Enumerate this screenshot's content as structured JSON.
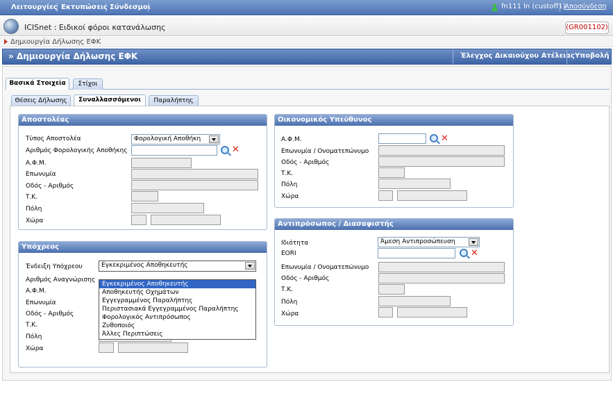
{
  "topbar": {
    "menu": [
      "Λειτουργίες",
      "Εκτυπώσεις",
      "Σύνδεσμοι"
    ],
    "user": "fn111 ln (custoff1)",
    "logout": "Αποσύνδεση",
    "user_icon": "user-icon"
  },
  "app": {
    "title": "ICISnet : Ειδικοί φόροι κατανάλωσης",
    "code": "(GR001102)"
  },
  "breadcrumb": "Δημιουργία Δήλωσης ΕΦΚ",
  "titlebar": {
    "title": "» Δημιουργία Δήλωσης ΕΦΚ",
    "check_button": "Έλεγχος Δικαιούχου Ατέλειας",
    "submit_button": "Υποβολή"
  },
  "tabs": [
    "Βασικά Στοιχεία",
    "Στίχοι"
  ],
  "subtabs": [
    "Θέσεις Δήλωσης",
    "Συναλλασσόμενοι",
    "Παραλήπτης"
  ],
  "sender": {
    "title": "Αποστολέας",
    "type_label": "Τύπος Αποστολέα",
    "type_value": "Φορολογική Αποθήκη",
    "warehouse_label": "Αριθμός Φορολογικής Αποθήκης",
    "afm_label": "Α.Φ.Μ.",
    "name_label": "Επωνυμία",
    "street_label": "Οδός - Αριθμός",
    "tk_label": "Τ.Κ.",
    "city_label": "Πόλη",
    "country_label": "Χώρα"
  },
  "obligor": {
    "title": "Υπόχρεος",
    "indication_label": "Ένδειξη Υπόχρεου",
    "indication_value": "Εγκεκριμένος Αποθηκευτής",
    "id_label": "Αριθμός Αναγνώρισης",
    "afm_label": "Α.Φ.Μ.",
    "name_label": "Επωνυμία",
    "street_label": "Οδός - Αριθμός",
    "tk_label": "Τ.Κ.",
    "city_label": "Πόλη",
    "country_label": "Χώρα"
  },
  "dropdown": {
    "options": [
      "Εγκεκριμένος Αποθηκευτής",
      "Αποθηκευτής Οχημάτων",
      "Εγγεγραμμένος Παραλήπτης",
      "Περιστασιακά Εγγεγραμμένος Παραλήπτης",
      "Φορολογικός Αντιπρόσωπος",
      "Ζυθοποιός",
      "Άλλες Περιπτώσεις"
    ],
    "selected": "Εγκεκριμένος Αποθηκευτής"
  },
  "financial": {
    "title": "Οικονομικός Υπεύθυνος",
    "afm_label": "Α.Φ.Μ.",
    "name_label": "Επωνυμία / Ονοματεπώνυμο",
    "street_label": "Οδός - Αριθμός",
    "tk_label": "Τ.Κ.",
    "city_label": "Πόλη",
    "country_label": "Χώρα"
  },
  "representative": {
    "title": "Αντιπρόσωπος / Διασαφιστής",
    "capacity_label": "Ιδιότητα",
    "capacity_value": "Άμεση Αντιπροσώπευση",
    "eori_label": "EORI",
    "name_label": "Επωνυμία / Ονοματεπώνυμο",
    "street_label": "Οδός - Αριθμός",
    "tk_label": "Τ.Κ.",
    "city_label": "Πόλη",
    "country_label": "Χώρα"
  }
}
